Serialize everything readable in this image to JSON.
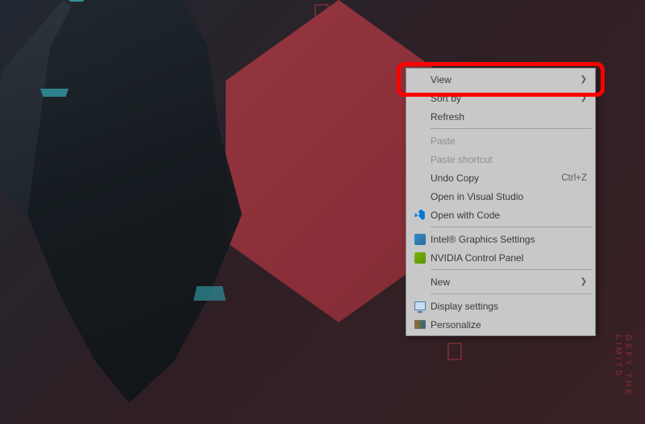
{
  "wallpaper": {
    "side_text": "DEFY THE LIMITS"
  },
  "context_menu": {
    "items": [
      {
        "label": "View",
        "has_submenu": true,
        "highlighted": true
      },
      {
        "label": "Sort by",
        "has_submenu": true
      },
      {
        "label": "Refresh"
      }
    ],
    "items2": [
      {
        "label": "Paste",
        "disabled": true
      },
      {
        "label": "Paste shortcut",
        "disabled": true
      },
      {
        "label": "Undo Copy",
        "shortcut": "Ctrl+Z"
      },
      {
        "label": "Open in Visual Studio"
      },
      {
        "label": "Open with Code",
        "icon": "vscode"
      }
    ],
    "items3": [
      {
        "label": "Intel® Graphics Settings",
        "icon": "intel"
      },
      {
        "label": "NVIDIA Control Panel",
        "icon": "nvidia"
      }
    ],
    "items4": [
      {
        "label": "New",
        "has_submenu": true
      }
    ],
    "items5": [
      {
        "label": "Display settings",
        "icon": "display"
      },
      {
        "label": "Personalize",
        "icon": "personalize"
      }
    ]
  }
}
